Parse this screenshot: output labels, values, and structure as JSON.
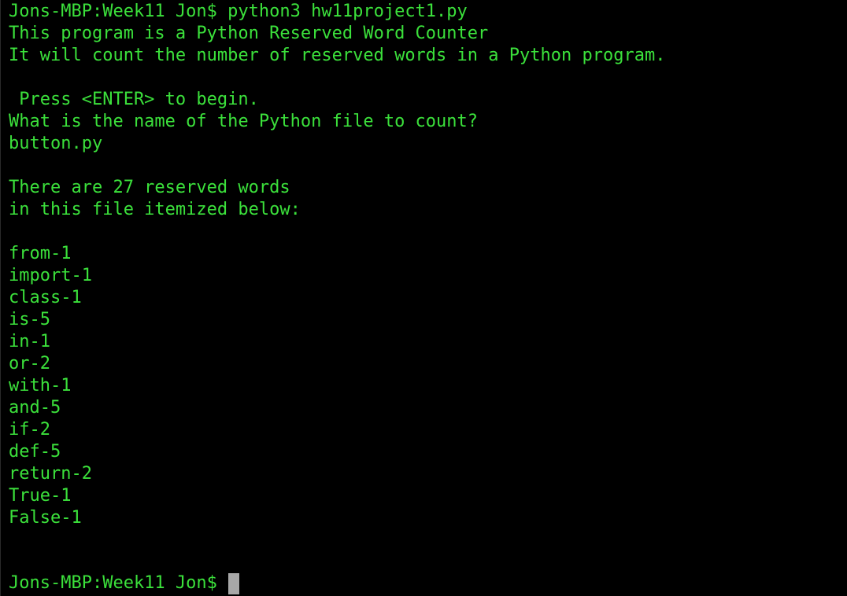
{
  "terminal": {
    "lines": [
      "Jons-MBP:Week11 Jon$ python3 hw11project1.py",
      "This program is a Python Reserved Word Counter",
      "It will count the number of reserved words in a Python program.",
      "",
      " Press <ENTER> to begin.",
      "What is the name of the Python file to count?",
      "button.py",
      "",
      "There are 27 reserved words",
      "in this file itemized below:",
      "",
      "from-1",
      "import-1",
      "class-1",
      "is-5",
      "in-1",
      "or-2",
      "with-1",
      "and-5",
      "if-2",
      "def-5",
      "return-2",
      "True-1",
      "False-1"
    ],
    "prompt": "Jons-MBP:Week11 Jon$ ",
    "text_color": "#3be03b",
    "background_color": "#000000",
    "cursor_color": "#a8a8a8"
  }
}
